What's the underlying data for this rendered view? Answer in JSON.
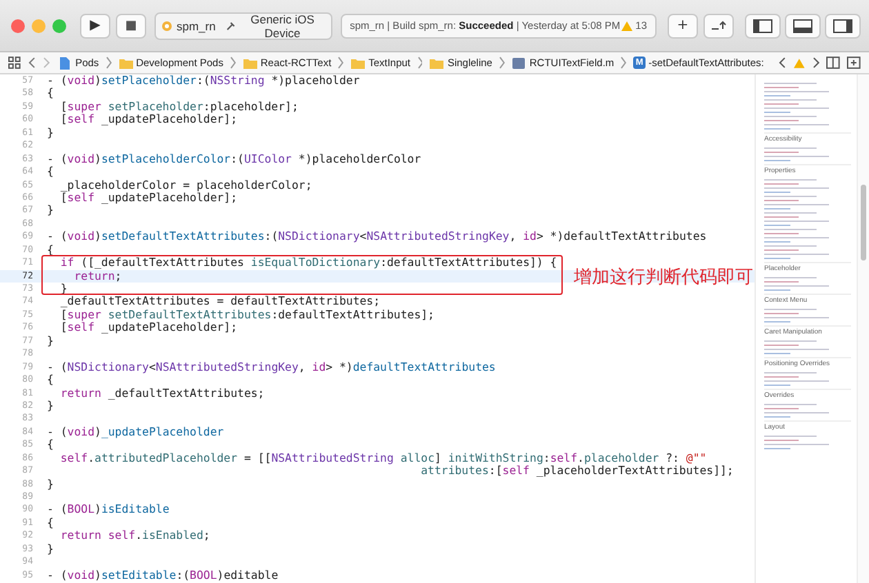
{
  "toolbar": {
    "run_label": "▶",
    "stop_label": "■",
    "scheme": "spm_rn",
    "device": "Generic iOS Device",
    "status": "spm_rn | Build spm_rn: **Succeeded** | Yesterday at 5:08 PM",
    "warning_count": "13",
    "add_label": "+"
  },
  "jump_bar": {
    "items": [
      {
        "kind": "project",
        "label": "Pods"
      },
      {
        "kind": "folder",
        "label": "Development Pods"
      },
      {
        "kind": "folder",
        "label": "React-RCTText"
      },
      {
        "kind": "folder",
        "label": "TextInput"
      },
      {
        "kind": "folder",
        "label": "Singleline"
      },
      {
        "kind": "file",
        "label": "RCTUITextField.m"
      },
      {
        "kind": "method",
        "badge": "M",
        "label": "-setDefaultTextAttributes:"
      }
    ]
  },
  "editor": {
    "blocks": [
      {
        "kind": "plain",
        "lines": [
          {
            "number": "57",
            "current": false,
            "segments": [
              {
                "kind": "plain",
                "text": "- ("
              },
              {
                "kind": "keyword",
                "text": "void"
              },
              {
                "kind": "plain",
                "text": ")"
              },
              {
                "kind": "method",
                "text": "setPlaceholder"
              },
              {
                "kind": "plain",
                "text": ":("
              },
              {
                "kind": "type",
                "text": "NSString"
              },
              {
                "kind": "plain",
                "text": " *)placeholder"
              }
            ]
          },
          {
            "number": "58",
            "current": false,
            "segments": [
              {
                "kind": "plain",
                "text": "{"
              }
            ]
          },
          {
            "number": "59",
            "current": false,
            "segments": [
              {
                "kind": "plain",
                "text": "  ["
              },
              {
                "kind": "keyword",
                "text": "super "
              },
              {
                "kind": "call",
                "text": "setPlaceholder"
              },
              {
                "kind": "plain",
                "text": ":placeholder];"
              }
            ]
          },
          {
            "number": "60",
            "current": false,
            "segments": [
              {
                "kind": "plain",
                "text": "  ["
              },
              {
                "kind": "keyword",
                "text": "self"
              },
              {
                "kind": "plain",
                "text": " _updatePlaceholder];"
              }
            ]
          },
          {
            "number": "61",
            "current": false,
            "segments": [
              {
                "kind": "plain",
                "text": "}"
              }
            ]
          },
          {
            "number": "62",
            "current": false
          },
          {
            "number": "63",
            "current": false,
            "segments": [
              {
                "kind": "plain",
                "text": "- ("
              },
              {
                "kind": "keyword",
                "text": "void"
              },
              {
                "kind": "plain",
                "text": ")"
              },
              {
                "kind": "method",
                "text": "setPlaceholderColor"
              },
              {
                "kind": "plain",
                "text": ":("
              },
              {
                "kind": "type",
                "text": "UIColor"
              },
              {
                "kind": "plain",
                "text": " *)placeholderColor"
              }
            ]
          },
          {
            "number": "64",
            "current": false,
            "segments": [
              {
                "kind": "plain",
                "text": "{"
              }
            ]
          },
          {
            "number": "65",
            "current": false,
            "segments": [
              {
                "kind": "plain",
                "text": "  _placeholderColor = placeholderColor;"
              }
            ]
          },
          {
            "number": "66",
            "current": false,
            "segments": [
              {
                "kind": "plain",
                "text": "  ["
              },
              {
                "kind": "keyword",
                "text": "self"
              },
              {
                "kind": "plain",
                "text": " _updatePlaceholder];"
              }
            ]
          },
          {
            "number": "67",
            "current": false,
            "segments": [
              {
                "kind": "plain",
                "text": "}"
              }
            ]
          },
          {
            "number": "68",
            "current": false
          },
          {
            "number": "69",
            "current": false,
            "segments": [
              {
                "kind": "plain",
                "text": "- ("
              },
              {
                "kind": "keyword",
                "text": "void"
              },
              {
                "kind": "plain",
                "text": ")"
              },
              {
                "kind": "method",
                "text": "setDefaultTextAttributes"
              },
              {
                "kind": "plain",
                "text": ":("
              },
              {
                "kind": "type",
                "text": "NSDictionary"
              },
              {
                "kind": "plain",
                "text": "<"
              },
              {
                "kind": "type",
                "text": "NSAttributedStringKey"
              },
              {
                "kind": "plain",
                "text": ", "
              },
              {
                "kind": "keyword",
                "text": "id"
              },
              {
                "kind": "plain",
                "text": "> *)defaultTextAttributes"
              }
            ]
          },
          {
            "number": "70",
            "current": false,
            "segments": [
              {
                "kind": "plain",
                "text": "{"
              }
            ]
          }
        ]
      },
      {
        "kind": "boxed",
        "annotation": "增加这行判断代码即可",
        "lines": [
          {
            "number": "71",
            "current": false,
            "segments": [
              {
                "kind": "keyword",
                "text": "  if"
              },
              {
                "kind": "plain",
                "text": " ([_defaultTextAttributes "
              },
              {
                "kind": "call",
                "text": "isEqualToDictionary"
              },
              {
                "kind": "plain",
                "text": ":defaultTextAttributes]) {"
              }
            ]
          },
          {
            "number": "72",
            "current": true,
            "segments": [
              {
                "kind": "keyword",
                "text": "    return"
              },
              {
                "kind": "plain",
                "text": ";"
              }
            ]
          },
          {
            "number": "73",
            "current": false,
            "segments": [
              {
                "kind": "plain",
                "text": "  }"
              }
            ]
          }
        ]
      },
      {
        "kind": "plain",
        "lines": [
          {
            "number": "74",
            "current": false,
            "segments": [
              {
                "kind": "plain",
                "text": "  _defaultTextAttributes = defaultTextAttributes;"
              }
            ]
          },
          {
            "number": "75",
            "current": false,
            "segments": [
              {
                "kind": "plain",
                "text": "  ["
              },
              {
                "kind": "keyword",
                "text": "super "
              },
              {
                "kind": "call",
                "text": "setDefaultTextAttributes"
              },
              {
                "kind": "plain",
                "text": ":defaultTextAttributes];"
              }
            ]
          },
          {
            "number": "76",
            "current": false,
            "segments": [
              {
                "kind": "plain",
                "text": "  ["
              },
              {
                "kind": "keyword",
                "text": "self"
              },
              {
                "kind": "plain",
                "text": " _updatePlaceholder];"
              }
            ]
          },
          {
            "number": "77",
            "current": false,
            "segments": [
              {
                "kind": "plain",
                "text": "}"
              }
            ]
          },
          {
            "number": "78",
            "current": false
          },
          {
            "number": "79",
            "current": false,
            "segments": [
              {
                "kind": "plain",
                "text": "- ("
              },
              {
                "kind": "type",
                "text": "NSDictionary"
              },
              {
                "kind": "plain",
                "text": "<"
              },
              {
                "kind": "type",
                "text": "NSAttributedStringKey"
              },
              {
                "kind": "plain",
                "text": ", "
              },
              {
                "kind": "keyword",
                "text": "id"
              },
              {
                "kind": "plain",
                "text": "> *)"
              },
              {
                "kind": "method",
                "text": "defaultTextAttributes"
              }
            ]
          },
          {
            "number": "80",
            "current": false,
            "segments": [
              {
                "kind": "plain",
                "text": "{"
              }
            ]
          },
          {
            "number": "81",
            "current": false,
            "segments": [
              {
                "kind": "keyword",
                "text": "  return"
              },
              {
                "kind": "plain",
                "text": " _defaultTextAttributes;"
              }
            ]
          },
          {
            "number": "82",
            "current": false,
            "segments": [
              {
                "kind": "plain",
                "text": "}"
              }
            ]
          },
          {
            "number": "83",
            "current": false
          },
          {
            "number": "84",
            "current": false,
            "segments": [
              {
                "kind": "plain",
                "text": "- ("
              },
              {
                "kind": "keyword",
                "text": "void"
              },
              {
                "kind": "plain",
                "text": ")"
              },
              {
                "kind": "method",
                "text": "_updatePlaceholder"
              }
            ]
          },
          {
            "number": "85",
            "current": false,
            "segments": [
              {
                "kind": "plain",
                "text": "{"
              }
            ]
          },
          {
            "number": "86",
            "current": false,
            "segments": [
              {
                "kind": "keyword",
                "text": "  self"
              },
              {
                "kind": "plain",
                "text": "."
              },
              {
                "kind": "call",
                "text": "attributedPlaceholder"
              },
              {
                "kind": "plain",
                "text": " = [["
              },
              {
                "kind": "type",
                "text": "NSAttributedString"
              },
              {
                "kind": "call",
                "text": " alloc"
              },
              {
                "kind": "plain",
                "text": "] "
              },
              {
                "kind": "call",
                "text": "initWithString"
              },
              {
                "kind": "plain",
                "text": ":"
              },
              {
                "kind": "keyword",
                "text": "self"
              },
              {
                "kind": "plain",
                "text": "."
              },
              {
                "kind": "call",
                "text": "placeholder"
              },
              {
                "kind": "plain",
                "text": " ?: "
              },
              {
                "kind": "string",
                "text": "@\"\""
              }
            ]
          },
          {
            "number": "87",
            "current": false,
            "segments": [
              {
                "kind": "call",
                "text": "                                                       attributes"
              },
              {
                "kind": "plain",
                "text": ":["
              },
              {
                "kind": "keyword",
                "text": "self"
              },
              {
                "kind": "plain",
                "text": " _placeholderTextAttributes]];"
              }
            ]
          },
          {
            "number": "88",
            "current": false,
            "segments": [
              {
                "kind": "plain",
                "text": "}"
              }
            ]
          },
          {
            "number": "89",
            "current": false
          },
          {
            "number": "90",
            "current": false,
            "segments": [
              {
                "kind": "plain",
                "text": "- ("
              },
              {
                "kind": "keyword",
                "text": "BOOL"
              },
              {
                "kind": "plain",
                "text": ")"
              },
              {
                "kind": "method",
                "text": "isEditable"
              }
            ]
          },
          {
            "number": "91",
            "current": false,
            "segments": [
              {
                "kind": "plain",
                "text": "{"
              }
            ]
          },
          {
            "number": "92",
            "current": false,
            "segments": [
              {
                "kind": "keyword",
                "text": "  return self"
              },
              {
                "kind": "plain",
                "text": "."
              },
              {
                "kind": "call",
                "text": "isEnabled"
              },
              {
                "kind": "plain",
                "text": ";"
              }
            ]
          },
          {
            "number": "93",
            "current": false,
            "segments": [
              {
                "kind": "plain",
                "text": "}"
              }
            ]
          },
          {
            "number": "94",
            "current": false
          },
          {
            "number": "95",
            "current": false,
            "segments": [
              {
                "kind": "plain",
                "text": "- ("
              },
              {
                "kind": "keyword",
                "text": "void"
              },
              {
                "kind": "plain",
                "text": ")"
              },
              {
                "kind": "method",
                "text": "setEditable"
              },
              {
                "kind": "plain",
                "text": ":("
              },
              {
                "kind": "keyword",
                "text": "BOOL"
              },
              {
                "kind": "plain",
                "text": ")editable"
              }
            ]
          }
        ]
      }
    ]
  },
  "minimap": {
    "headings": [
      "Accessibility",
      "Properties",
      "Placeholder",
      "Context Menu",
      "Caret Manipulation",
      "Positioning Overrides",
      "Overrides",
      "Layout"
    ]
  }
}
